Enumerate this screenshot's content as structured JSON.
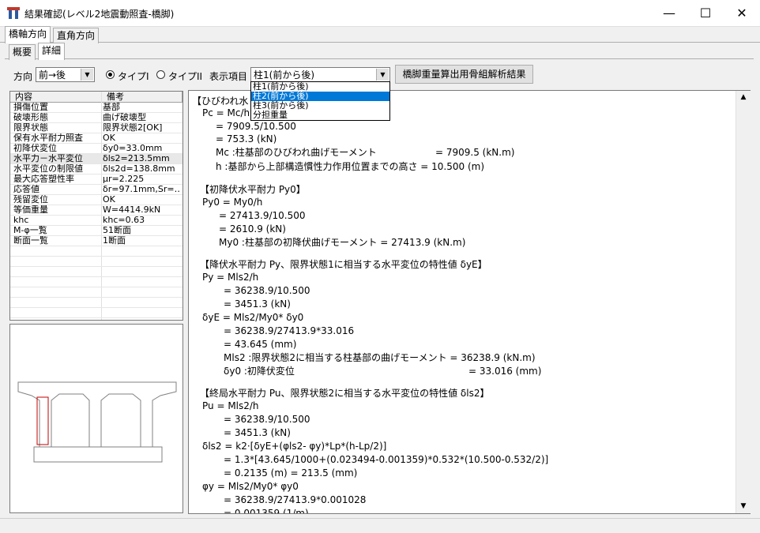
{
  "window": {
    "title": "結果確認(レベル2地震動照査-橋脚)",
    "minimize": "—",
    "maximize": "☐",
    "close": "✕"
  },
  "tabs_main": [
    "橋軸方向",
    "直角方向"
  ],
  "tabs_sub": [
    "概要",
    "詳細"
  ],
  "toolbar": {
    "direction_label": "方向",
    "direction_value": "前→後",
    "type1_label": "タイプI",
    "type2_label": "タイプII",
    "display_label": "表示項目",
    "display_value": "柱1(前から後)",
    "calc_button": "橋脚重量算出用骨組解析結果"
  },
  "dropdown_options": [
    "柱1(前から後)",
    "柱2(前から後)",
    "柱3(前から後)",
    "分担重量"
  ],
  "dropdown_selected_index": 1,
  "grid": {
    "headers": [
      "内容",
      "備考"
    ],
    "rows": [
      [
        "損傷位置",
        "基部"
      ],
      [
        "破壊形態",
        "曲げ破壊型"
      ],
      [
        "限界状態",
        "限界状態2[OK]"
      ],
      [
        "保有水平耐力照査",
        "OK"
      ],
      [
        "初降伏変位",
        "δy0=33.0mm"
      ],
      [
        "水平力－水平変位",
        "δls2=213.5mm"
      ],
      [
        "水平変位の制限値",
        "δls2d=138.8mm"
      ],
      [
        "最大応答塑性率",
        "μr=2.225"
      ],
      [
        "応答値",
        "δr=97.1mm,Sr=…"
      ],
      [
        "残留変位",
        "OK"
      ],
      [
        "等価重量",
        "W=4414.9kN"
      ],
      [
        "khc",
        "khc=0.63"
      ],
      [
        "M-φ一覧",
        "51断面"
      ],
      [
        "断面一覧",
        "1断面"
      ]
    ]
  },
  "report_lines": [
    "【ひびわれ水",
    "Pc = Mc/h",
    "= 7909.5/10.500",
    "= 753.3 (kN)",
    "Mc :柱基部のひびわれ曲げモーメント",
    "= 7909.5 (kN.m)",
    "h  :基部から上部構造慣性力作用位置までの高さ = 10.500 (m)",
    "【初降伏水平耐力  Py0】",
    "Py0 = My0/h",
    "= 27413.9/10.500",
    "= 2610.9 (kN)",
    "My0 :柱基部の初降伏曲げモーメント = 27413.9 (kN.m)",
    "【降伏水平耐力  Py、限界状態1に相当する水平変位の特性値  δyE】",
    "Py   = Mls2/h",
    "= 36238.9/10.500",
    "= 3451.3 (kN)",
    "δyE = Mls2/My0* δy0",
    "= 36238.9/27413.9*33.016",
    "= 43.645 (mm)",
    "Mls2 :限界状態2に相当する柱基部の曲げモーメント = 36238.9 (kN.m)",
    "δy0 :初降伏変位",
    "= 33.016 (mm)",
    "【終局水平耐力  Pu、限界状態2に相当する水平変位の特性値  δls2】",
    "Pu   = Mls2/h",
    "= 36238.9/10.500",
    "= 3451.3 (kN)",
    "δls2 = k2·[δyE+(φls2- φy)*Lp*(h-Lp/2)]",
    "= 1.3*[43.645/1000+(0.023494-0.001359)*0.532*(10.500-0.532/2)]",
    "= 0.2135 (m) = 213.5 (mm)",
    "φy   = Mls2/My0* φy0",
    "= 36238.9/27413.9*0.001028",
    "= 0.001359 (1/m)"
  ],
  "icons": {
    "app": "app-icon",
    "dropdown_arrow": "chevron-down-icon",
    "scroll_up": "▲",
    "scroll_down": "▼"
  },
  "colors": {
    "selection": "#0078d7",
    "column_highlight": "#c00000"
  }
}
